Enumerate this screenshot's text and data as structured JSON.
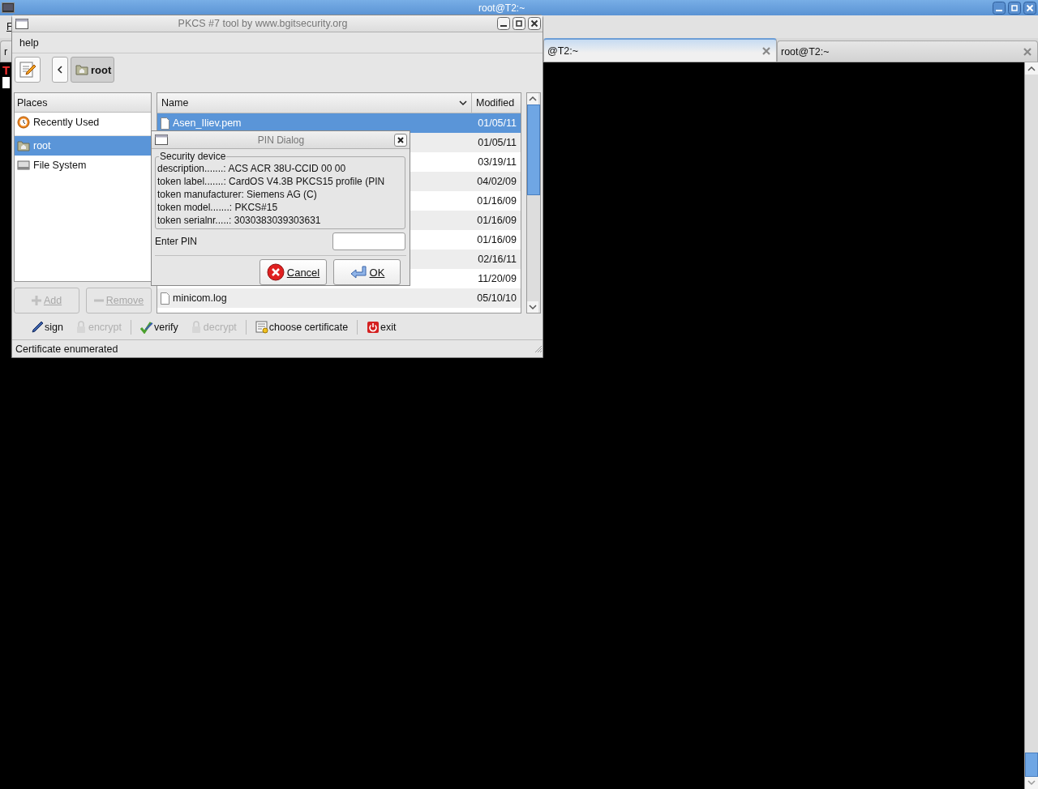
{
  "terminal_window": {
    "title": "root@T2:~",
    "menu_fragment": "F",
    "tabs": [
      {
        "label": "r",
        "selected": false
      },
      {
        "label": "@T2:~",
        "selected": true
      },
      {
        "label": "root@T2:~",
        "selected": false
      }
    ],
    "terminal_text": "T"
  },
  "pkcs_window": {
    "title": "PKCS #7 tool by www.bgitsecurity.org",
    "menu": [
      "help"
    ],
    "path_button": "root",
    "places": {
      "heading": "Places",
      "items": [
        {
          "label": "Recently Used",
          "kind": "recent",
          "selected": false
        },
        {
          "label": "root",
          "kind": "folder",
          "selected": true
        },
        {
          "label": "File System",
          "kind": "drive",
          "selected": false
        }
      ],
      "add": "Add",
      "remove": "Remove"
    },
    "files": {
      "columns": [
        "Name",
        "Modified"
      ],
      "rows": [
        {
          "name": "Asen_Iliev.pem",
          "modified": "01/05/11",
          "selected": true
        },
        {
          "modified": "01/05/11",
          "selected": false
        },
        {
          "modified": "03/19/11",
          "selected": false
        },
        {
          "modified": "04/02/09",
          "selected": false
        },
        {
          "modified": "01/16/09",
          "selected": false
        },
        {
          "modified": "01/16/09",
          "selected": false
        },
        {
          "modified": "01/16/09",
          "selected": false
        },
        {
          "modified": "02/16/11",
          "selected": false
        },
        {
          "modified": "11/20/09",
          "selected": false
        },
        {
          "name": "minicom.log",
          "modified": "05/10/10",
          "selected": false
        }
      ]
    },
    "actions": [
      {
        "label": "sign",
        "kind": "sign",
        "disabled": false
      },
      {
        "label": "encrypt",
        "kind": "lock",
        "disabled": true
      },
      {
        "label": "verify",
        "kind": "verify",
        "disabled": false
      },
      {
        "label": "decrypt",
        "kind": "lock",
        "disabled": true
      },
      {
        "label": "choose certificate",
        "kind": "cert",
        "disabled": false
      },
      {
        "label": "exit",
        "kind": "exit",
        "disabled": false
      }
    ],
    "status": "Certificate enumerated"
  },
  "pin_dialog": {
    "title": "PIN Dialog",
    "group_title": "Security device",
    "lines": [
      "description.......: ACS ACR 38U-CCID 00 00",
      "token label.......: CardOS V4.3B PKCS15 profile (PIN",
      "token manufacturer: Siemens AG (C)",
      "token model.......: PKCS#15",
      "token serialnr.....: 3030383039303631"
    ],
    "pin_label": "Enter PIN",
    "cancel": "Cancel",
    "ok": "OK"
  }
}
